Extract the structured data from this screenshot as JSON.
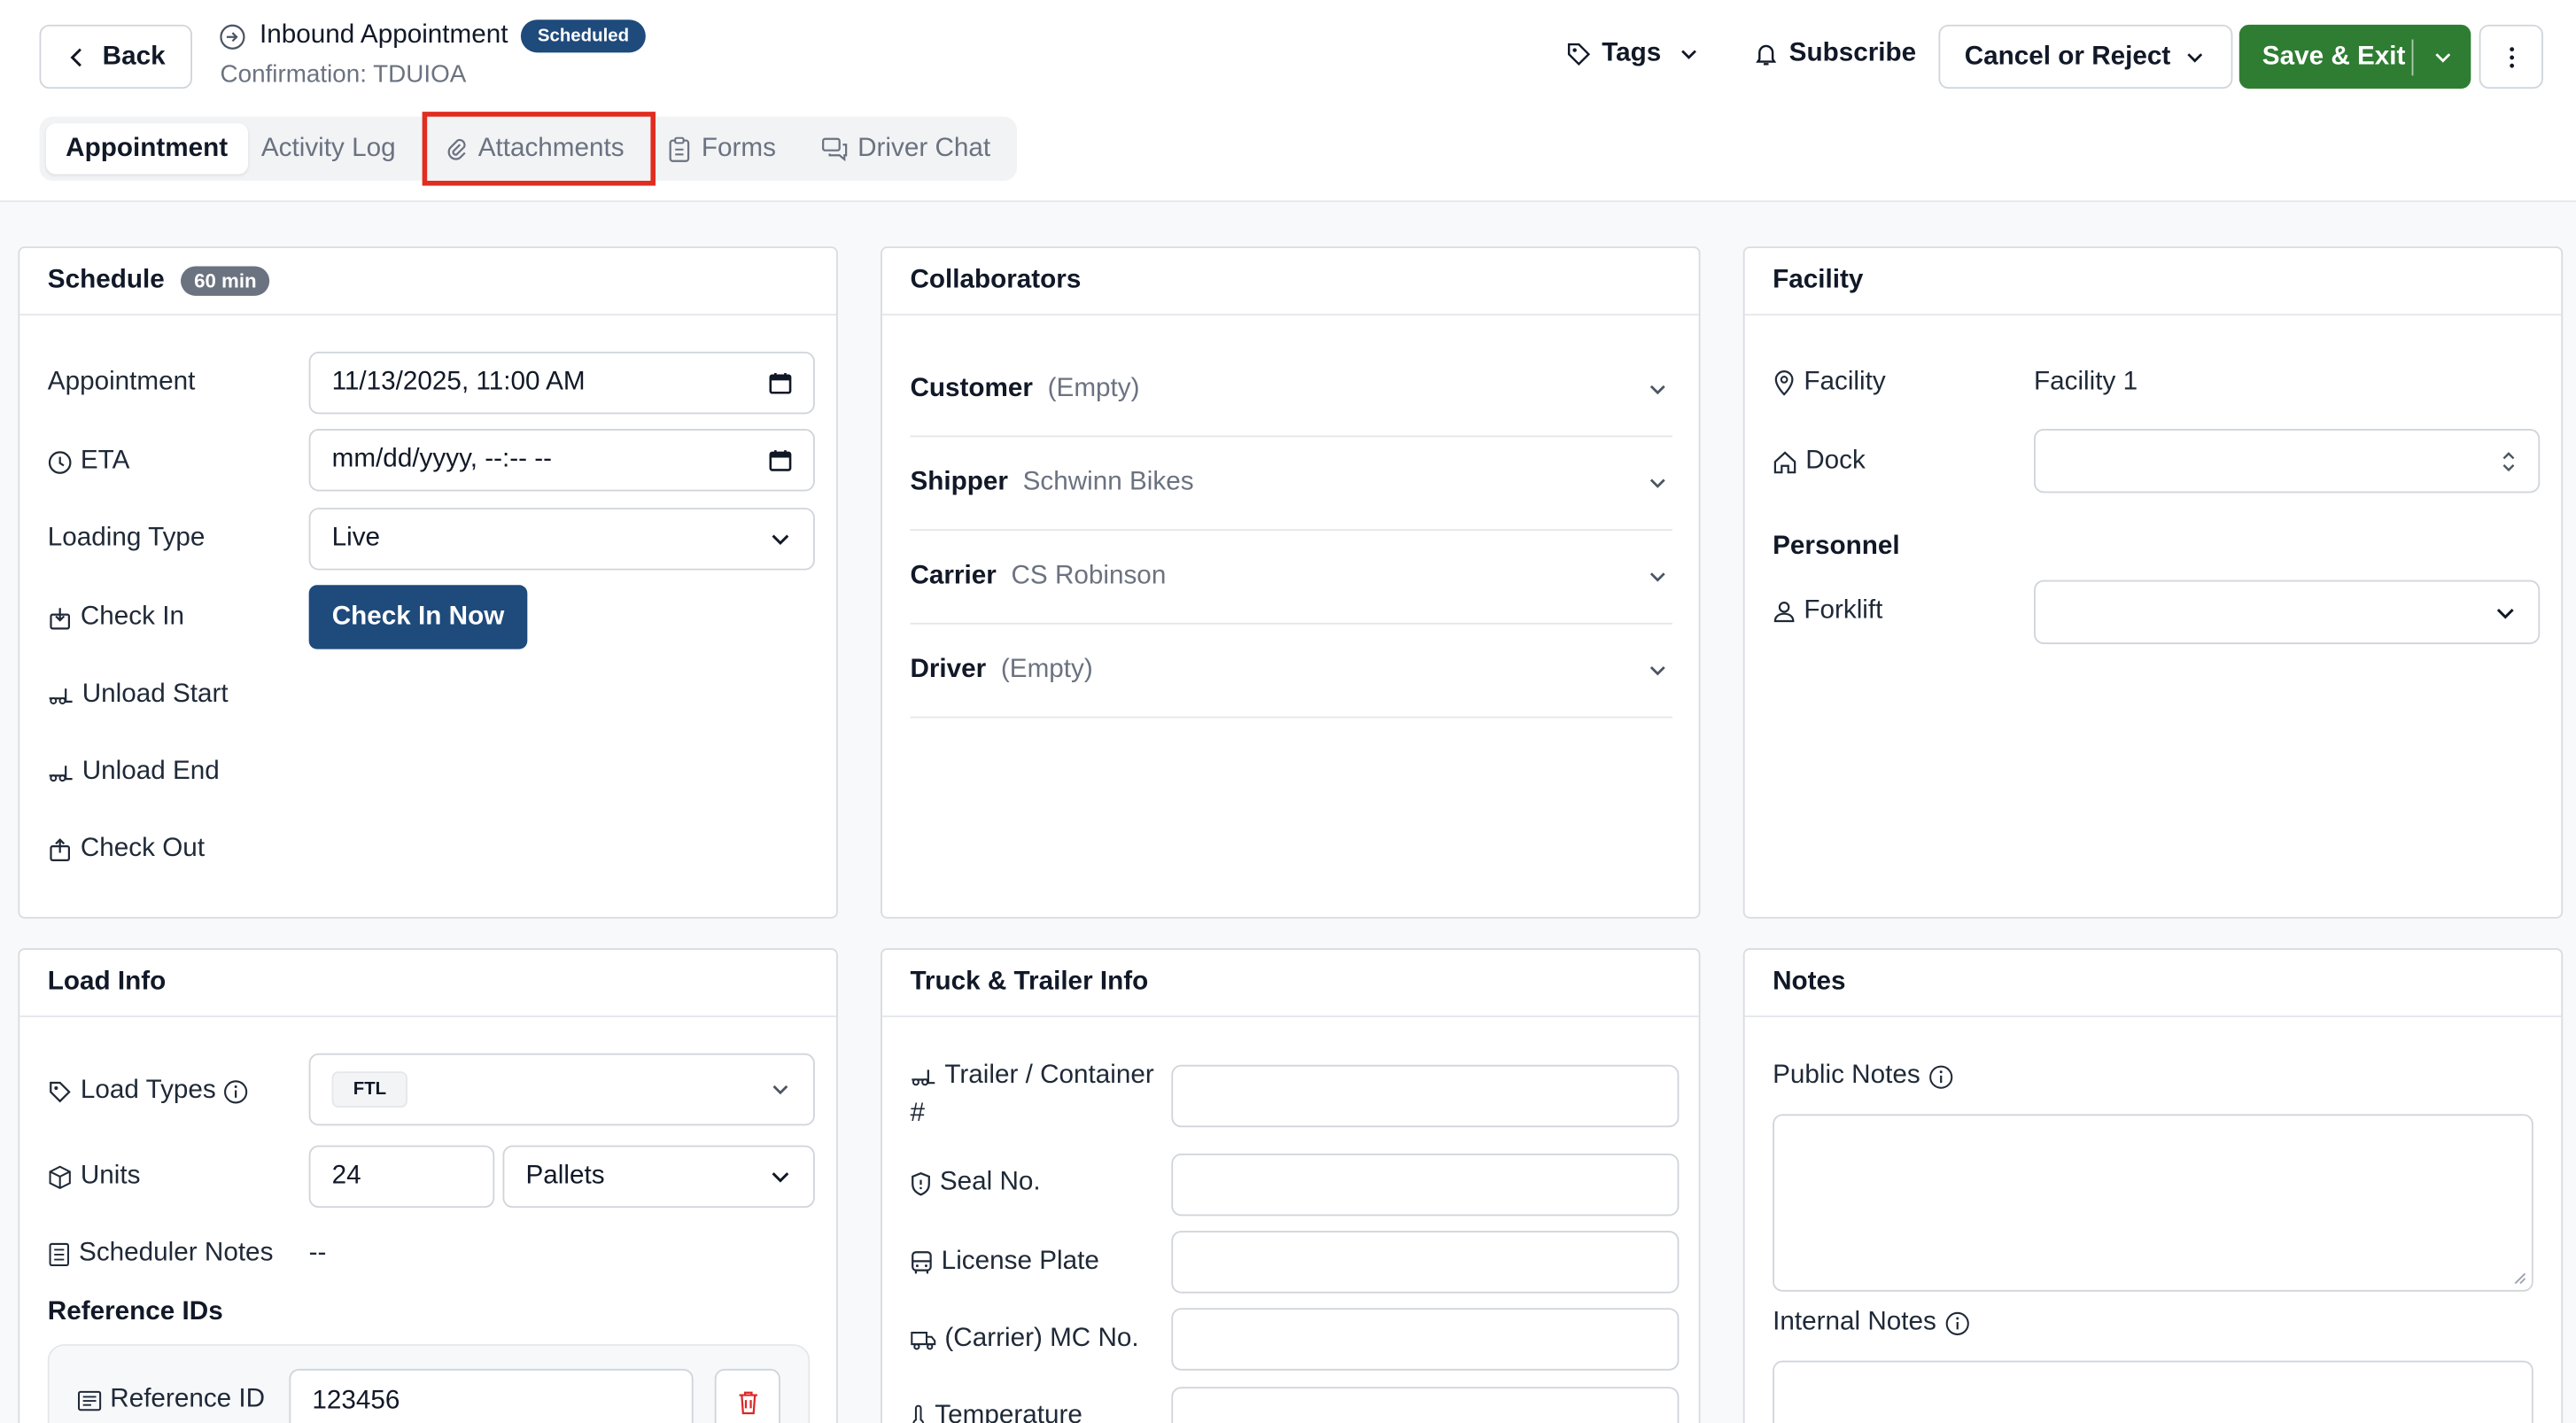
{
  "header": {
    "back_label": "Back",
    "title": "Inbound Appointment",
    "status_badge": "Scheduled",
    "confirmation": "Confirmation: TDUIOA",
    "tags_label": "Tags",
    "subscribe_label": "Subscribe",
    "cancel_label": "Cancel or Reject",
    "save_label": "Save & Exit"
  },
  "tabs": [
    {
      "label": "Appointment",
      "active": true
    },
    {
      "label": "Activity Log"
    },
    {
      "label": "Attachments",
      "highlighted": true
    },
    {
      "label": "Forms"
    },
    {
      "label": "Driver Chat"
    }
  ],
  "schedule": {
    "title": "Schedule",
    "duration": "60 min",
    "appointment_label": "Appointment",
    "appointment_value": "11/13/2025, 11:00  AM",
    "eta_label": "ETA",
    "eta_value": "mm/dd/yyyy, --:-- --",
    "loading_type_label": "Loading Type",
    "loading_type_value": "Live",
    "check_in_label": "Check In",
    "check_in_button": "Check In Now",
    "unload_start_label": "Unload Start",
    "unload_end_label": "Unload End",
    "check_out_label": "Check Out"
  },
  "collaborators": {
    "title": "Collaborators",
    "items": [
      {
        "label": "Customer",
        "value": "(Empty)"
      },
      {
        "label": "Shipper",
        "value": "Schwinn Bikes"
      },
      {
        "label": "Carrier",
        "value": "CS Robinson"
      },
      {
        "label": "Driver",
        "value": "(Empty)"
      }
    ]
  },
  "facility": {
    "title": "Facility",
    "facility_label": "Facility",
    "facility_value": "Facility 1",
    "dock_label": "Dock",
    "personnel_title": "Personnel",
    "forklift_label": "Forklift"
  },
  "load_info": {
    "title": "Load Info",
    "load_types_label": "Load Types",
    "load_type_tag": "FTL",
    "units_label": "Units",
    "units_value": "24",
    "units_type": "Pallets",
    "scheduler_notes_label": "Scheduler Notes",
    "scheduler_notes_value": "--",
    "reference_ids_title": "Reference IDs",
    "reference_id_label": "Reference ID",
    "reference_id_value": "123456"
  },
  "truck": {
    "title": "Truck & Trailer Info",
    "trailer_label_1": "Trailer / Container",
    "trailer_label_2": "#",
    "seal_label": "Seal No.",
    "plate_label": "License Plate",
    "mc_label": "(Carrier) MC No.",
    "temp_label": "Temperature"
  },
  "notes": {
    "title": "Notes",
    "public_label": "Public Notes",
    "internal_label": "Internal Notes"
  },
  "colors": {
    "primary": "#1e4a7c",
    "save": "#2f7d32",
    "highlight": "#e02d20",
    "delete": "#dc2626"
  }
}
